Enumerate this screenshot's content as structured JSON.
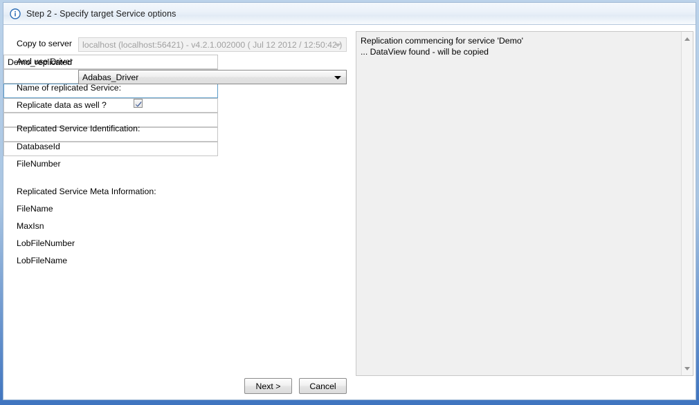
{
  "window": {
    "title": "Step 2 - Specify target Service options",
    "info_icon": "info-circle-icon"
  },
  "form": {
    "server_row": {
      "label": "Copy to server",
      "value": "localhost (localhost:56421) - v4.2.1.002000 ( Jul 12 2012 / 12:50:42 )",
      "enabled": false
    },
    "driver_row": {
      "label": "And use Driver",
      "value": "Adabas_Driver",
      "enabled": true
    },
    "service_name": {
      "label": "Name of replicated Service:",
      "value": "Demo_replicated",
      "placeholder": ""
    },
    "replicate_data": {
      "label": "Replicate data as well ?",
      "checked": true
    },
    "identification_heading": "Replicated Service Identification:",
    "identification_fields": [
      {
        "label": "DatabaseId",
        "value": "",
        "focused": false
      },
      {
        "label": "FileNumber",
        "value": "",
        "focused": true
      }
    ],
    "meta_heading": "Replicated Service Meta Information:",
    "meta_fields": [
      {
        "label": "FileName",
        "value": "",
        "focused": false
      },
      {
        "label": "MaxIsn",
        "value": "",
        "focused": false
      },
      {
        "label": "LobFileNumber",
        "value": "",
        "focused": false
      },
      {
        "label": "LobFileName",
        "value": "",
        "focused": false
      }
    ]
  },
  "log": {
    "lines": [
      "Replication commencing for service 'Demo'",
      "... DataView found - will be copied"
    ],
    "text": "Replication commencing for service 'Demo'\n... DataView found - will be copied",
    "scrollbar": {
      "up_arrow": "scroll-up-arrow-icon",
      "down_arrow": "scroll-down-arrow-icon"
    }
  },
  "buttons": {
    "next": "Next >",
    "cancel": "Cancel"
  },
  "colors": {
    "frame_blue": "#3f74bf",
    "focus_border": "#5b9bc8",
    "check_blue": "#3b5998"
  }
}
